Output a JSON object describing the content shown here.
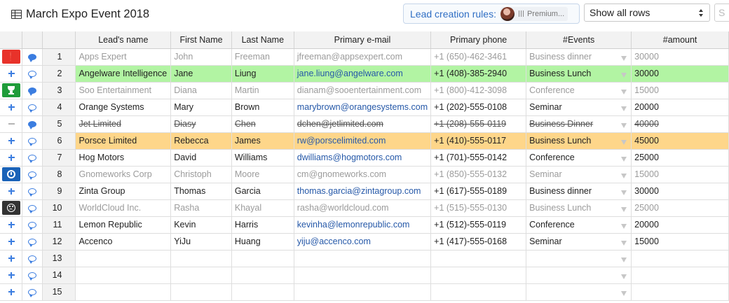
{
  "header": {
    "title": "March Expo Event 2018",
    "rules_label": "Lead creation rules:",
    "rules_chip": "Premium...",
    "view_select": "Show all rows",
    "stub_text": "S"
  },
  "columns": [
    "Lead's name",
    "First Name",
    "Last Name",
    "Primary e-mail",
    "Primary phone",
    "#Events",
    "#amount"
  ],
  "status_icons": {
    "alert": "exclamation-icon",
    "trophy": "trophy-icon",
    "clock": "clock-icon",
    "sad": "sad-face-icon",
    "add": "plus-icon",
    "remove": "minus-icon",
    "comment": "comment-bubble-icon"
  },
  "colors": {
    "green_row": "#b2f4a3",
    "orange_row": "#fed68a",
    "link": "#2558a8",
    "accent": "#3b7de0"
  },
  "rows": [
    {
      "n": "1",
      "status": "alert",
      "comment": "filled",
      "style": "gray",
      "lead": "Apps Expert",
      "first": "John",
      "last": "Freeman",
      "email": "jfreeman@appsexpert.com",
      "phone": "+1 (650)-462-3461",
      "event": "Business dinner",
      "amount": "30000"
    },
    {
      "n": "2",
      "status": "add",
      "comment": "outline",
      "style": "green",
      "lead": "Angelware Intelligence",
      "first": "Jane",
      "last": "Liung",
      "email": "jane.liung@angelware.com",
      "phone": "+1 (408)-385-2940",
      "event": "Business Lunch",
      "amount": "30000"
    },
    {
      "n": "3",
      "status": "trophy",
      "comment": "filled",
      "style": "gray",
      "lead": "Soo Entertainment",
      "first": "Diana",
      "last": "Martin",
      "email": "dianam@sooentertainment.com",
      "phone": "+1 (800)-412-3098",
      "event": "Conference",
      "amount": "15000"
    },
    {
      "n": "4",
      "status": "add",
      "comment": "outline",
      "style": "",
      "lead": "Orange Systems",
      "first": "Mary",
      "last": "Brown",
      "email": "marybrown@orangesystems.com",
      "phone": "+1 (202)-555-0108",
      "event": "Seminar",
      "amount": "20000"
    },
    {
      "n": "5",
      "status": "remove",
      "comment": "filled",
      "style": "strike",
      "lead": "Jet Limited",
      "first": "Diasy",
      "last": "Chen",
      "email": "dchen@jetlimited.com",
      "phone": "+1 (208)-555-0119",
      "event": "Business Dinner",
      "amount": "40000"
    },
    {
      "n": "6",
      "status": "add",
      "comment": "outline",
      "style": "orange",
      "lead": "Porsce Limited",
      "first": "Rebecca",
      "last": "James",
      "email": "rw@porscelimited.com",
      "phone": "+1 (410)-555-0117",
      "event": "Business Lunch",
      "amount": "45000"
    },
    {
      "n": "7",
      "status": "add",
      "comment": "outline",
      "style": "",
      "lead": "Hog Motors",
      "first": "David",
      "last": "Williams",
      "email": "dwilliams@hogmotors.com",
      "phone": "+1 (701)-555-0142",
      "event": "Conference",
      "amount": "25000"
    },
    {
      "n": "8",
      "status": "clock",
      "comment": "outline",
      "style": "gray",
      "lead": "Gnomeworks Corp",
      "first": "Christoph",
      "last": "Moore",
      "email": "cm@gnomeworks.com",
      "phone": "+1 (850)-555-0132",
      "event": "Seminar",
      "amount": "15000"
    },
    {
      "n": "9",
      "status": "add",
      "comment": "outline",
      "style": "",
      "lead": "Zinta Group",
      "first": "Thomas",
      "last": "Garcia",
      "email": "thomas.garcia@zintagroup.com",
      "phone": "+1 (617)-555-0189",
      "event": "Business dinner",
      "amount": "30000"
    },
    {
      "n": "10",
      "status": "sad",
      "comment": "outline",
      "style": "gray",
      "lead": "WorldCloud Inc.",
      "first": "Rasha",
      "last": "Khayal",
      "email": "rasha@worldcloud.com",
      "phone": "+1 (515)-555-0130",
      "event": "Business Lunch",
      "amount": "25000"
    },
    {
      "n": "11",
      "status": "add",
      "comment": "outline",
      "style": "",
      "lead": "Lemon Republic",
      "first": "Kevin",
      "last": "Harris",
      "email": "kevinha@lemonrepublic.com",
      "phone": "+1 (512)-555-0119",
      "event": "Conference",
      "amount": "20000"
    },
    {
      "n": "12",
      "status": "add",
      "comment": "outline",
      "style": "",
      "lead": "Accenco",
      "first": "YiJu",
      "last": "Huang",
      "email": "yiju@accenco.com",
      "phone": "+1 (417)-555-0168",
      "event": "Seminar",
      "amount": "15000"
    },
    {
      "n": "13",
      "status": "add",
      "comment": "outline",
      "style": "",
      "lead": "",
      "first": "",
      "last": "",
      "email": "",
      "phone": "",
      "event": "",
      "amount": ""
    },
    {
      "n": "14",
      "status": "add",
      "comment": "outline",
      "style": "",
      "lead": "",
      "first": "",
      "last": "",
      "email": "",
      "phone": "",
      "event": "",
      "amount": ""
    },
    {
      "n": "15",
      "status": "add",
      "comment": "outline",
      "style": "",
      "lead": "",
      "first": "",
      "last": "",
      "email": "",
      "phone": "",
      "event": "",
      "amount": ""
    }
  ]
}
